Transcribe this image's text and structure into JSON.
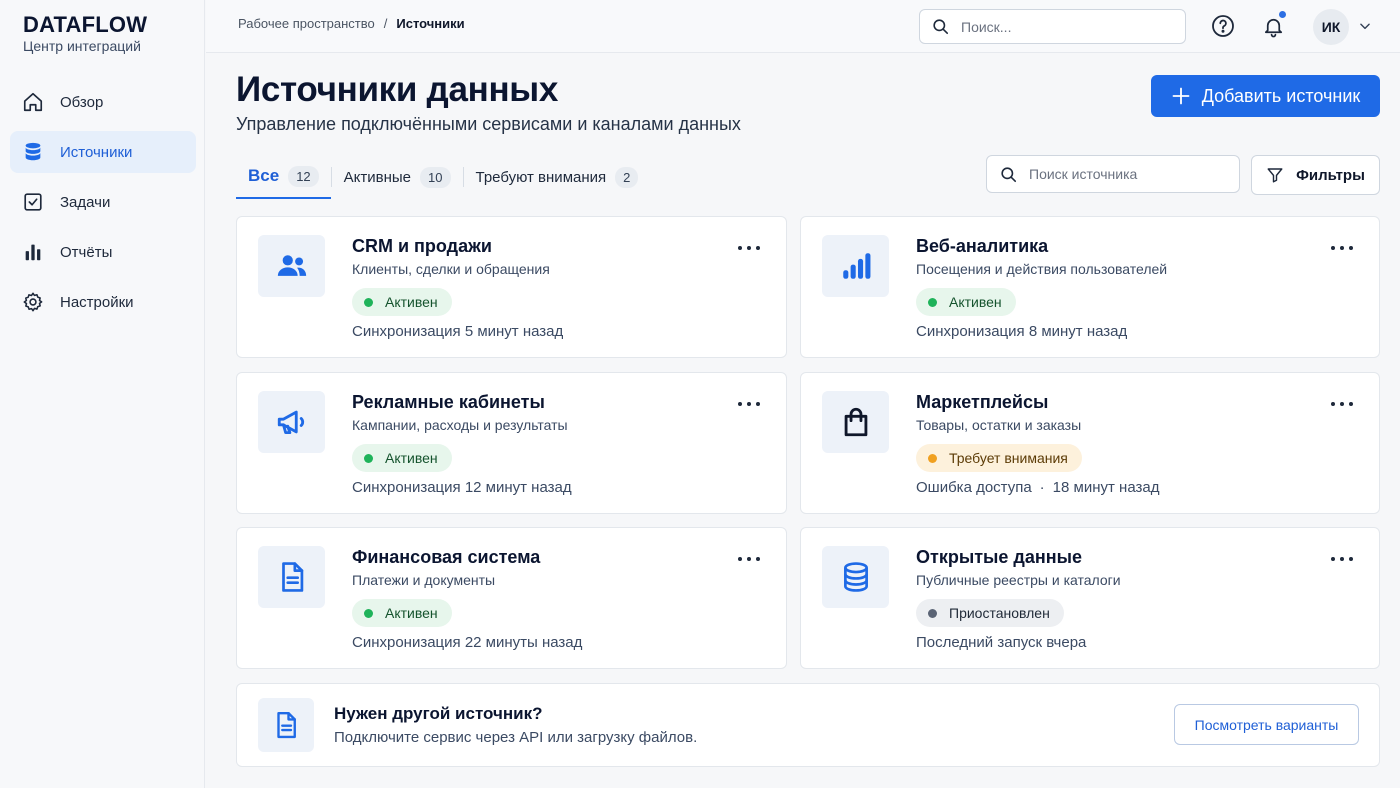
{
  "brand": {
    "title": "DATAFLOW",
    "subtitle": "Центр интеграций"
  },
  "sidebar": {
    "items": [
      {
        "label": "Обзор",
        "icon": "home-icon",
        "active": false
      },
      {
        "label": "Источники",
        "icon": "database-icon",
        "active": true
      },
      {
        "label": "Задачи",
        "icon": "checkbox-icon",
        "active": false
      },
      {
        "label": "Отчёты",
        "icon": "bar-chart-icon",
        "active": false
      },
      {
        "label": "Настройки",
        "icon": "gear-icon",
        "active": false
      }
    ]
  },
  "topbar": {
    "breadcrumb": {
      "parent": "Рабочее пространство",
      "separator": "/",
      "current": "Источники"
    },
    "search_placeholder": "Поиск...",
    "avatar_initials": "ИК"
  },
  "header": {
    "title": "Источники данных",
    "subtitle": "Управление подключёнными сервисами и каналами данных",
    "add_button": "Добавить источник"
  },
  "tabs": [
    {
      "label": "Все",
      "count": "12",
      "active": true
    },
    {
      "label": "Активные",
      "count": "10",
      "active": false
    },
    {
      "label": "Требуют внимания",
      "count": "2",
      "active": false
    }
  ],
  "toolbar": {
    "search_placeholder": "Поиск источника",
    "filter_label": "Фильтры"
  },
  "sources": [
    {
      "name": "CRM и продажи",
      "desc": "Клиенты, сделки и обращения",
      "status": "Активен",
      "meta": "Синхронизация 5 минут назад",
      "icon": "users-icon"
    },
    {
      "name": "Веб-аналитика",
      "desc": "Посещения и действия пользователей",
      "status": "Активен",
      "meta": "Синхронизация 8 минут назад",
      "icon": "bar-chart-icon"
    },
    {
      "name": "Рекламные кабинеты",
      "desc": "Кампании, расходы и результаты",
      "status": "Активен",
      "meta": "Синхронизация 12 минут назад",
      "icon": "megaphone-icon"
    },
    {
      "name": "Маркетплейсы",
      "desc": "Товары, остатки и заказы",
      "status": "Требует внимания",
      "meta": "Ошибка доступа",
      "meta2": "18 минут назад",
      "icon": "shopping-bag-icon"
    },
    {
      "name": "Финансовая система",
      "desc": "Платежи и документы",
      "status": "Активен",
      "meta": "Синхронизация 22 минуты назад",
      "icon": "document-icon"
    },
    {
      "name": "Открытые данные",
      "desc": "Публичные реестры и каталоги",
      "status": "Приостановлен",
      "meta": "Последний запуск вчера",
      "icon": "database-icon"
    }
  ],
  "cta": {
    "title": "Нужен другой источник?",
    "subtitle": "Подключите сервис через API или загрузку файлов.",
    "button": "Посмотреть варианты"
  },
  "colors": {
    "accent": "#1f6ae6",
    "active_status": "#1fb35a",
    "warning_status": "#f0a020",
    "paused_status": "#5b6475"
  }
}
